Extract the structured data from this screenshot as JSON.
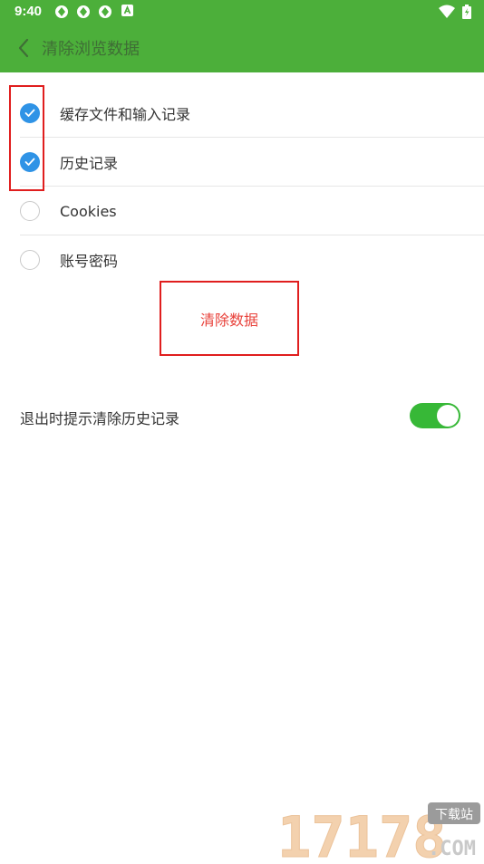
{
  "status_bar": {
    "time": "9:40",
    "icons_left": [
      "sync-icon",
      "sync-icon",
      "sync-icon",
      "a-badge-icon"
    ],
    "icons_right": [
      "wifi-icon",
      "battery-icon"
    ]
  },
  "header": {
    "title": "清除浏览数据",
    "back_icon": "chevron-left-icon",
    "background": "#4caf3a"
  },
  "options": [
    {
      "label": "缓存文件和输入记录",
      "checked": true
    },
    {
      "label": "历史记录",
      "checked": true
    },
    {
      "label": "Cookies",
      "checked": false
    },
    {
      "label": "账号密码",
      "checked": false
    }
  ],
  "clear_button": {
    "label": "清除数据",
    "color": "#e8413a"
  },
  "exit_setting": {
    "label": "退出时提示清除历史记录",
    "enabled": true
  },
  "watermark": {
    "text": "17178",
    "badge": "下载站",
    "suffix": ".COM"
  },
  "colors": {
    "accent": "#2f93e6",
    "toggle_on": "#37b837",
    "highlight": "#e01e1e"
  }
}
